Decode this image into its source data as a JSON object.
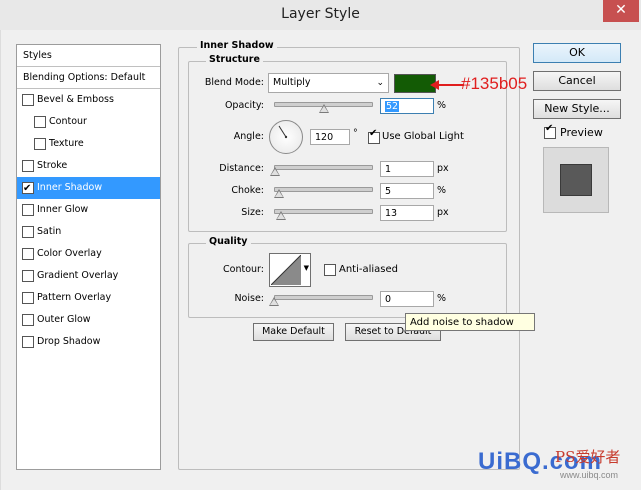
{
  "window": {
    "title": "Layer Style",
    "close_glyph": "✕"
  },
  "style_list": {
    "items": [
      {
        "label": "Styles",
        "kind": "header",
        "checked": false
      },
      {
        "label": "Blending Options: Default",
        "kind": "header",
        "checked": false
      },
      {
        "label": "Bevel & Emboss",
        "kind": "item",
        "checked": false
      },
      {
        "label": "Contour",
        "kind": "sub",
        "checked": false
      },
      {
        "label": "Texture",
        "kind": "sub",
        "checked": false
      },
      {
        "label": "Stroke",
        "kind": "item",
        "checked": false
      },
      {
        "label": "Inner Shadow",
        "kind": "item",
        "checked": true,
        "active": true
      },
      {
        "label": "Inner Glow",
        "kind": "item",
        "checked": false
      },
      {
        "label": "Satin",
        "kind": "item",
        "checked": false
      },
      {
        "label": "Color Overlay",
        "kind": "item",
        "checked": false
      },
      {
        "label": "Gradient Overlay",
        "kind": "item",
        "checked": false
      },
      {
        "label": "Pattern Overlay",
        "kind": "item",
        "checked": false
      },
      {
        "label": "Outer Glow",
        "kind": "item",
        "checked": false
      },
      {
        "label": "Drop Shadow",
        "kind": "item",
        "checked": false
      }
    ]
  },
  "inner_shadow": {
    "title": "Inner Shadow",
    "structure": {
      "title": "Structure",
      "blend_mode_label": "Blend Mode:",
      "blend_mode_value": "Multiply",
      "swatch_color": "#135b05",
      "opacity_label": "Opacity:",
      "opacity_value": "52",
      "opacity_unit": "%",
      "opacity_fraction": 0.52,
      "angle_label": "Angle:",
      "angle_value": "120",
      "angle_unit": "°",
      "use_global_light_label": "Use Global Light",
      "use_global_light_checked": true,
      "distance_label": "Distance:",
      "distance_value": "1",
      "distance_unit": "px",
      "distance_fraction": 0.01,
      "choke_label": "Choke:",
      "choke_value": "5",
      "choke_unit": "%",
      "choke_fraction": 0.05,
      "size_label": "Size:",
      "size_value": "13",
      "size_unit": "px",
      "size_fraction": 0.07
    },
    "quality": {
      "title": "Quality",
      "contour_label": "Contour:",
      "anti_aliased_label": "Anti-aliased",
      "anti_aliased_checked": false,
      "noise_label": "Noise:",
      "noise_value": "0",
      "noise_unit": "%",
      "noise_fraction": 0.0
    },
    "make_default_label": "Make Default",
    "reset_default_label": "Reset to Default"
  },
  "tooltip": "Add noise to shadow",
  "right_panel": {
    "ok_label": "OK",
    "cancel_label": "Cancel",
    "new_style_label": "New Style...",
    "preview_label": "Preview",
    "preview_checked": true
  },
  "annotation": {
    "text": "#135b05",
    "color": "#e01e1e"
  },
  "watermark": {
    "logo": "UiBQ.com",
    "sub": "www.uibq.com",
    "cn": "PS爱好者"
  }
}
